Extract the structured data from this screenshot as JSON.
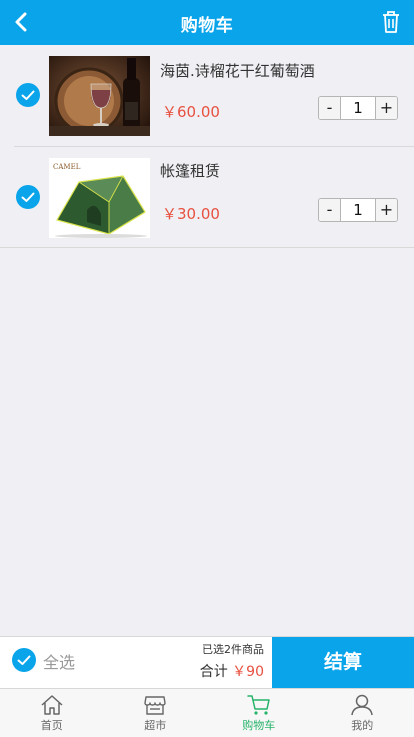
{
  "header": {
    "title": "购物车",
    "back_icon": "chevron-left-icon",
    "delete_icon": "trash-icon"
  },
  "cart": {
    "items": [
      {
        "name": "海茵.诗榴花干红葡萄酒",
        "price": "￥60.00",
        "quantity": "1",
        "checked": true,
        "image": "red-wine-bottle-and-glass"
      },
      {
        "name": "帐篷租赁",
        "price": "￥30.00",
        "quantity": "1",
        "checked": true,
        "image": "green-camping-tent",
        "image_brand": "CAMEL"
      }
    ],
    "minus_label": "-",
    "plus_label": "+"
  },
  "footer": {
    "select_all_label": "全选",
    "selected_count": "已选2件商品",
    "total_label": "合计",
    "total_amount": "￥90",
    "checkout_label": "结算"
  },
  "tabbar": {
    "tabs": [
      {
        "label": "首页",
        "icon": "home-icon",
        "active": false
      },
      {
        "label": "超市",
        "icon": "store-icon",
        "active": false
      },
      {
        "label": "购物车",
        "icon": "cart-icon",
        "active": true
      },
      {
        "label": "我的",
        "icon": "user-icon",
        "active": false
      }
    ]
  },
  "colors": {
    "primary": "#09a4ea",
    "price": "#e8503f",
    "active_tab": "#27b36a",
    "background": "#efeff4"
  }
}
